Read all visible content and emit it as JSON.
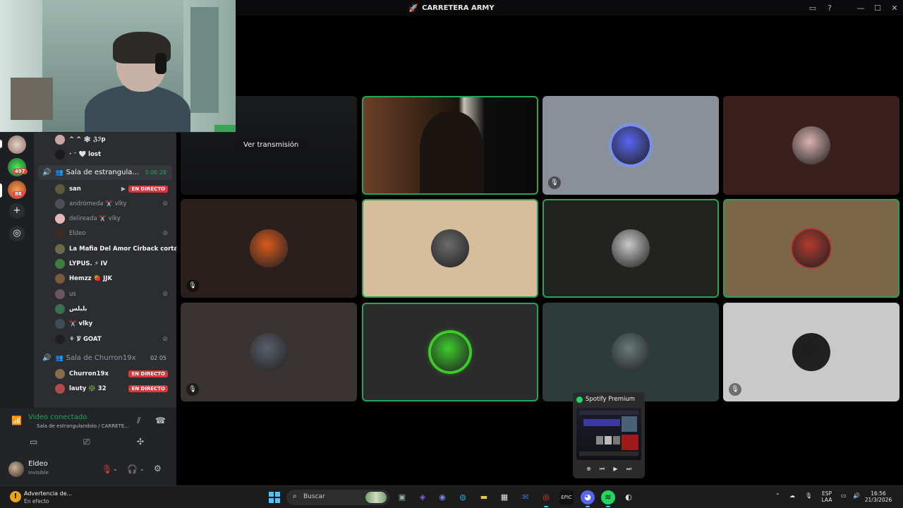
{
  "window": {
    "title": "CARRETERA ARMY"
  },
  "servers": {
    "badges": [
      "497",
      "88"
    ]
  },
  "channels": {
    "top_users": [
      {
        "name": "^ ^ 🕸 ℨℐp",
        "color": "#c9a6a0"
      },
      {
        "name": "· ⁻ 🤍 lost",
        "color": "#1b1b1b"
      }
    ],
    "voice_channel_1": {
      "name": "Sala de estrangula...",
      "timer": "3:06:28",
      "members": [
        {
          "name": "san",
          "live": "EN DIRECTO",
          "bold": true,
          "muted": false,
          "color": "#5d5a3c"
        },
        {
          "name": "andrómeda ✂️ vlky",
          "live": "",
          "bold": false,
          "muted": true,
          "color": "#4e5058"
        },
        {
          "name": "delireada ✂️ vlky",
          "live": "",
          "bold": false,
          "muted": false,
          "color": "#e6b7b7"
        },
        {
          "name": "Eldeo",
          "live": "",
          "bold": false,
          "muted": true,
          "color": "#3b2d22"
        },
        {
          "name": "La Mafia Del Amor Cirback corta",
          "live": "",
          "bold": true,
          "muted": false,
          "color": "#6b6b4a"
        },
        {
          "name": "LYPUS. ⚡ IV",
          "live": "",
          "bold": true,
          "muted": false,
          "color": "#3f7d3f"
        },
        {
          "name": "𝗛𝗲𝗺𝘇𝘇 🍓 JJK",
          "live": "",
          "bold": true,
          "muted": false,
          "color": "#7a5a3a"
        },
        {
          "name": "us",
          "live": "",
          "bold": false,
          "muted": true,
          "color": "#6a5560"
        },
        {
          "name": "ﺑﻠﺒﻠﺲ",
          "live": "",
          "bold": true,
          "muted": false,
          "color": "#3a6e4f"
        },
        {
          "name": "✂️ vlky",
          "live": "",
          "bold": true,
          "muted": false,
          "color": "#3f4d55"
        },
        {
          "name": "⚘ ℣ GOAT",
          "live": "",
          "bold": true,
          "muted": true,
          "color": "#202020"
        }
      ]
    },
    "voice_channel_2": {
      "name": "Sala de Churron19x",
      "count_a": "02",
      "count_b": "05",
      "members": [
        {
          "name": "𝗖𝗵𝘂𝗿𝗿𝗼𝗻𝟭𝟵𝘅",
          "live": "EN DIRECTO",
          "color": "#8a6b4a"
        },
        {
          "name": "lauty ❇️ 32",
          "live": "EN DIRECTO",
          "color": "#b14a4a"
        }
      ]
    }
  },
  "voice_panel": {
    "status": "Video conectado",
    "location": "Sala de estrangulandolo / CARRETE...",
    "user": {
      "name": "Eldeo",
      "status": "Invisible"
    }
  },
  "stage": {
    "stream_button": "Ver transmisión",
    "tiles": [
      {
        "id": "stream-preview",
        "bg": "#1a1b1d",
        "speaking": false,
        "muted": false
      },
      {
        "id": "camera-video",
        "bg": "#2b1d14",
        "speaking": true,
        "muted": false
      },
      {
        "id": "discord-default",
        "bg": "#8a8f99",
        "speaking": false,
        "muted": true,
        "avatar": "#5865f2"
      },
      {
        "id": "cat-ears-avatar",
        "bg": "#3b1f1f",
        "speaking": false,
        "muted": false,
        "avatar": "#d9b3b0"
      },
      {
        "id": "orange-hood-avatar",
        "bg": "#2a1f1c",
        "speaking": false,
        "muted": true,
        "avatar": "#d85a1c"
      },
      {
        "id": "mirror-selfie-avatar",
        "bg": "#d6bd9b",
        "speaking": true,
        "muted": false,
        "avatar": "#6b6b6b"
      },
      {
        "id": "angel-avatar",
        "bg": "#22231f",
        "speaking": true,
        "muted": false,
        "avatar": "#c9c9c9"
      },
      {
        "id": "red-ring-avatar",
        "bg": "#7d6548",
        "speaking": true,
        "muted": false,
        "avatar": "#b33a2f"
      },
      {
        "id": "photo-avatar-1",
        "bg": "#3a3331",
        "speaking": false,
        "muted": true,
        "avatar": "#5a5f6a"
      },
      {
        "id": "green-ring-avatar",
        "bg": "#2b2b2b",
        "speaking": true,
        "muted": false,
        "avatar": "#3ccc2a"
      },
      {
        "id": "photo-avatar-2",
        "bg": "#2e3b3b",
        "speaking": false,
        "muted": false,
        "avatar": "#6a7a7a"
      },
      {
        "id": "chrome-avatar",
        "bg": "#c9c9c9",
        "speaking": false,
        "muted": true,
        "avatar": "#1e1e1e"
      }
    ]
  },
  "spotify": {
    "title": "Spotify Premium"
  },
  "taskbar": {
    "warning_title": "Advertencia de...",
    "warning_sub": "En efecto",
    "search_placeholder": "Buscar",
    "lang_top": "ESP",
    "lang_bottom": "LAA",
    "time": "16:56",
    "date": "21/3/2026"
  },
  "colors": {
    "accent_green": "#23a559",
    "live_red": "#da373c",
    "discord_blurple": "#5865f2"
  }
}
